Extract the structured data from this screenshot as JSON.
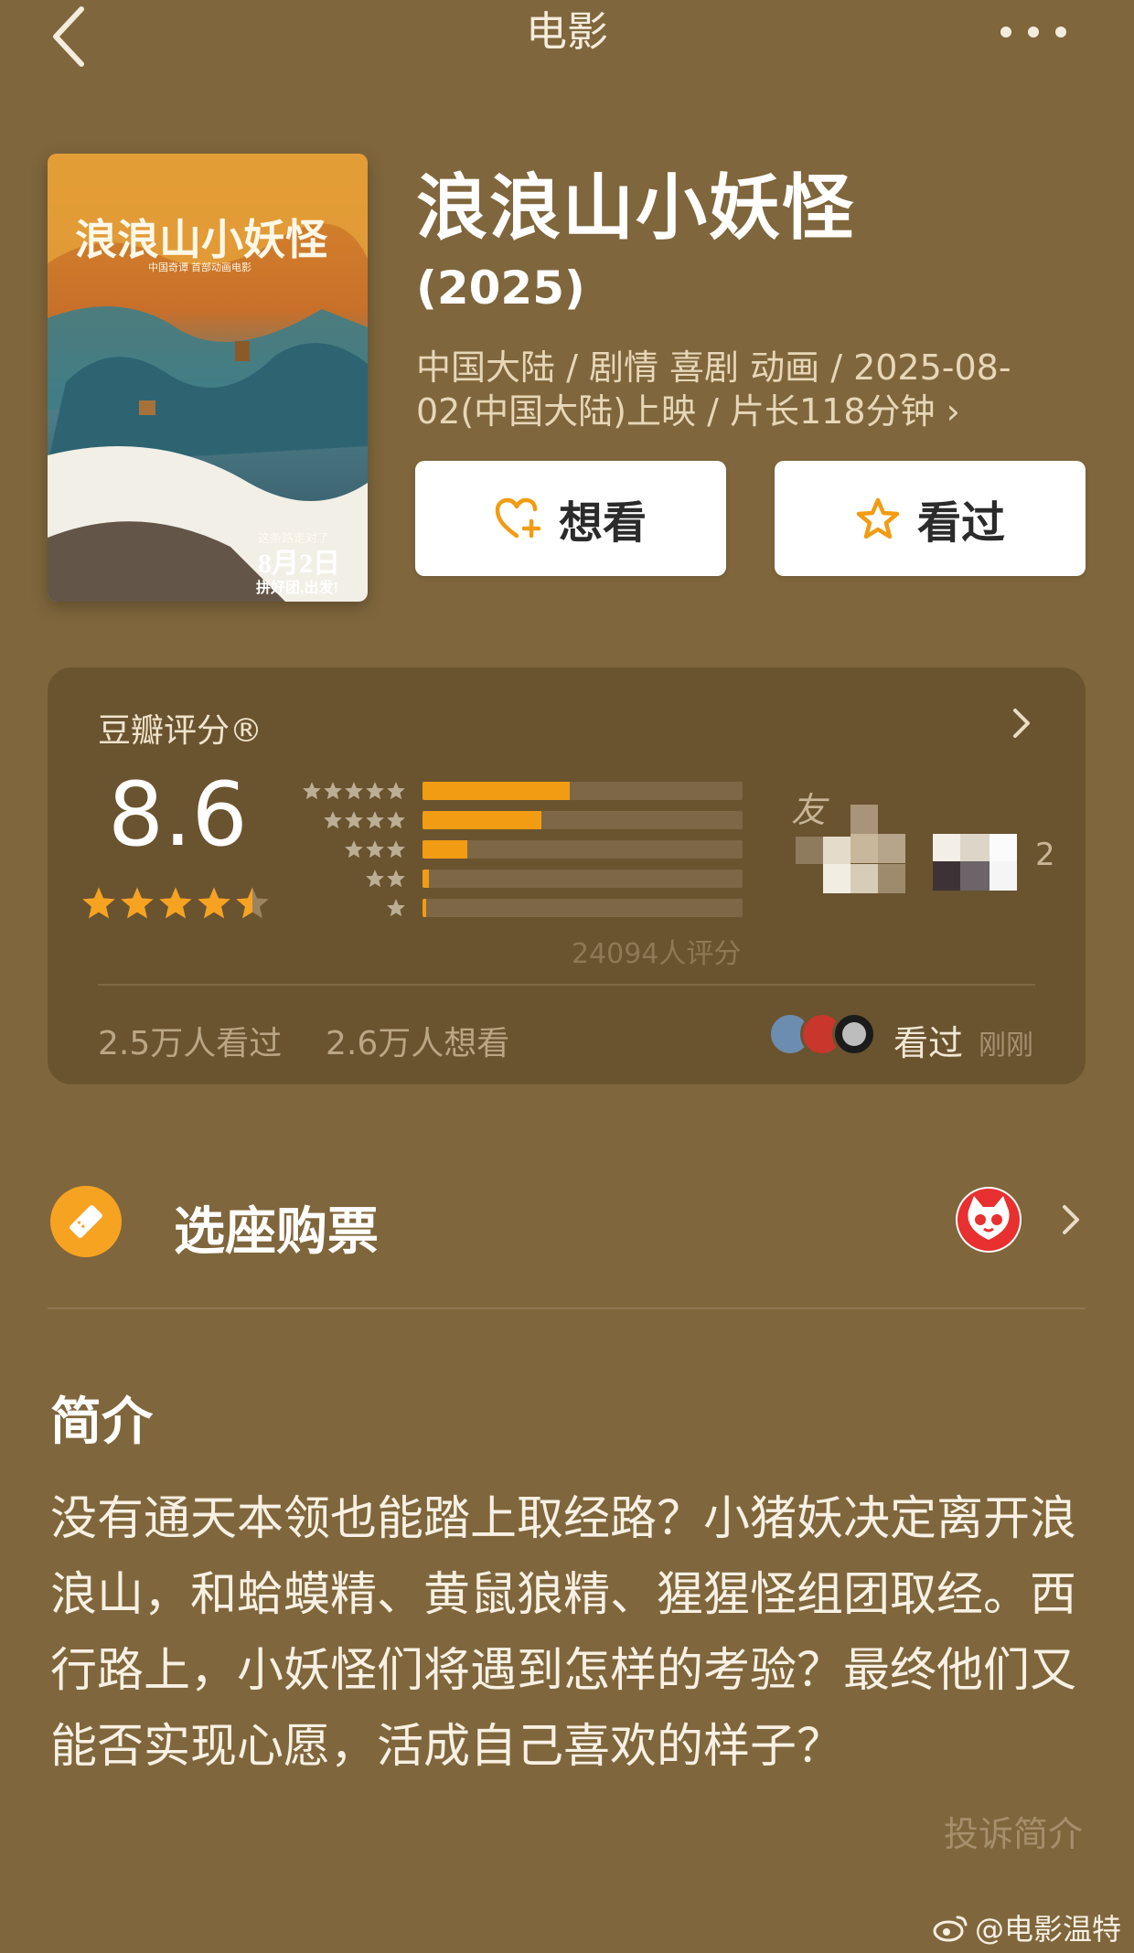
{
  "nav": {
    "title": "电影"
  },
  "movie": {
    "poster_text": {
      "title": "浪浪山小妖怪",
      "subtitle": "中国奇谭 首部动画电影",
      "tagline": "这条路走对了",
      "date": "8月2日",
      "slogan": "拼好团,出发!"
    },
    "title": "浪浪山小妖怪",
    "year": "(2025)",
    "meta": "中国大陆 / 剧情 喜剧 动画 / 2025-08-02(中国大陆)上映 / 片长118分钟 ›",
    "want_label": "想看",
    "seen_label": "看过"
  },
  "rating": {
    "label": "豆瓣评分®",
    "score": "8.6",
    "stars": 4.5,
    "distribution": [
      {
        "stars": 5,
        "percent": 46
      },
      {
        "stars": 4,
        "percent": 37
      },
      {
        "stars": 3,
        "percent": 14
      },
      {
        "stars": 2,
        "percent": 2
      },
      {
        "stars": 1,
        "percent": 1
      }
    ],
    "count": "24094人评分",
    "friends_count": "2",
    "seen_count": "2.5万人看过",
    "want_count": "2.6万人想看",
    "recent_label": "看过",
    "recent_time": "刚刚"
  },
  "ticket": {
    "label": "选座购票"
  },
  "intro": {
    "title": "简介",
    "body": "没有通天本领也能踏上取经路？小猪妖决定离开浪浪山，和蛤蟆精、黄鼠狼精、猩猩怪组团取经。西行路上，小妖怪们将遇到怎样的考验？最终他们又能否实现心愿，活成自己喜欢的样子？",
    "report": "投诉简介"
  },
  "watermark": "@电影温特",
  "colors": {
    "background": "#7f663c",
    "card": "#6a532f",
    "accent": "#f29c13",
    "star": "#f7a322"
  },
  "icons": [
    "back-arrow-icon",
    "more-icon",
    "heart-plus-icon",
    "star-outline-icon",
    "chevron-right-icon",
    "ticket-icon",
    "maoyan-cat-icon",
    "weibo-icon"
  ]
}
